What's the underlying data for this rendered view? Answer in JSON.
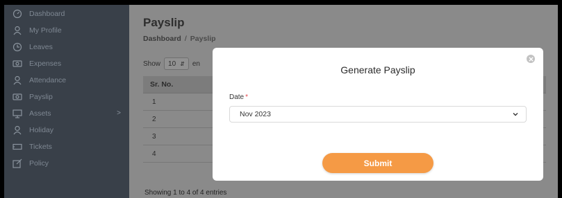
{
  "sidebar": {
    "items": [
      {
        "label": "Dashboard",
        "icon": "dashboard-gauge-icon"
      },
      {
        "label": "My Profile",
        "icon": "user-icon"
      },
      {
        "label": "Leaves",
        "icon": "clock-icon"
      },
      {
        "label": "Expenses",
        "icon": "money-icon"
      },
      {
        "label": "Attendance",
        "icon": "user-icon"
      },
      {
        "label": "Payslip",
        "icon": "money-icon"
      },
      {
        "label": "Assets",
        "icon": "monitor-icon",
        "arrow": ">"
      },
      {
        "label": "Holiday",
        "icon": "user-icon"
      },
      {
        "label": "Tickets",
        "icon": "ticket-icon"
      },
      {
        "label": "Policy",
        "icon": "edit-icon"
      }
    ]
  },
  "header": {
    "title": "Payslip",
    "breadcrumb": {
      "root": "Dashboard",
      "separator": "/",
      "current": "Payslip"
    }
  },
  "table_controls": {
    "show_label": "Show",
    "page_size": "10",
    "entries_label": "en"
  },
  "table": {
    "header": "Sr. No.",
    "rows": [
      "1",
      "2",
      "3",
      "4"
    ]
  },
  "footer": {
    "showing": "Showing 1 to 4 of 4 entries"
  },
  "modal": {
    "title": "Generate Payslip",
    "date_label": "Date",
    "required_mark": "*",
    "date_value": "Nov 2023",
    "submit_label": "Submit"
  },
  "colors": {
    "sidebar_bg": "#394049",
    "accent": "#f59a45",
    "required": "#e5484d"
  }
}
